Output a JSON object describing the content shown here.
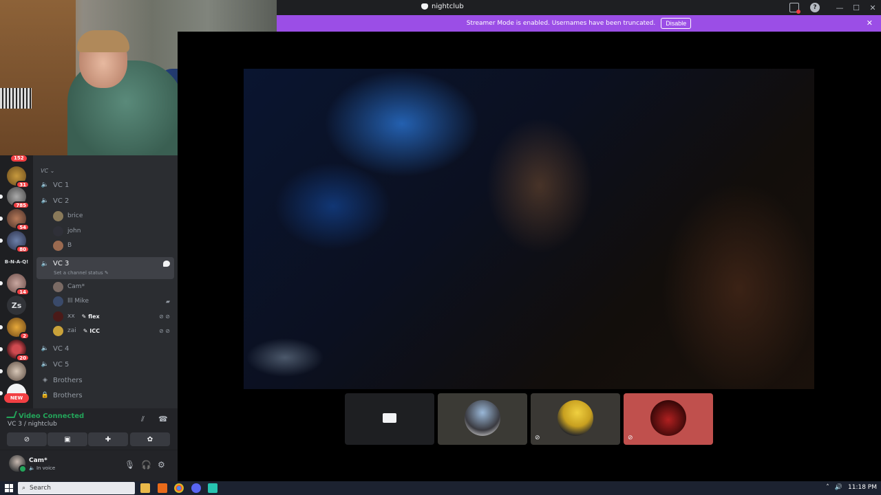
{
  "window": {
    "title": "nightclub",
    "controls": [
      "—",
      "☐",
      "✕"
    ]
  },
  "banner": {
    "text": "Streamer Mode is enabled. Usernames have been truncated.",
    "button": "Disable",
    "close": "✕"
  },
  "rail": {
    "top_badge": "152",
    "servers": [
      {
        "badge": "31"
      },
      {
        "badge": "785"
      },
      {
        "badge": "54"
      },
      {
        "badge": "80"
      },
      {
        "label": "B-N-A-Q!"
      },
      {
        "badge": "14"
      },
      {
        "label": "Zs"
      },
      {
        "badge": "2"
      },
      {
        "badge": "20"
      },
      {
        "badge": ""
      }
    ],
    "new_label": "NEW"
  },
  "channels": {
    "category": "VC ⌄",
    "vc1": "VC 1",
    "vc2": "VC 2",
    "vc2_users": [
      "brice",
      "john",
      "B"
    ],
    "vc3": "VC 3",
    "vc3_status": "Set a channel status ✎",
    "vc3_users": [
      {
        "name": "Cam*",
        "tag": ""
      },
      {
        "name": "lll Mike",
        "tag": ""
      },
      {
        "name": "xx",
        "tag": "✎ flex"
      },
      {
        "name": "zai",
        "tag": "✎ ICC"
      }
    ],
    "vc4": "VC 4",
    "vc5": "VC 5",
    "brothers_voice": "Brothers",
    "brothers_locked": "Brothers"
  },
  "voice": {
    "state": "Video Connected",
    "channel": "VC 3 / nightclub"
  },
  "user": {
    "name": "Cam*",
    "status": "🔈 In voice"
  },
  "taskbar": {
    "search": "Search",
    "time": "11:18 PM"
  }
}
